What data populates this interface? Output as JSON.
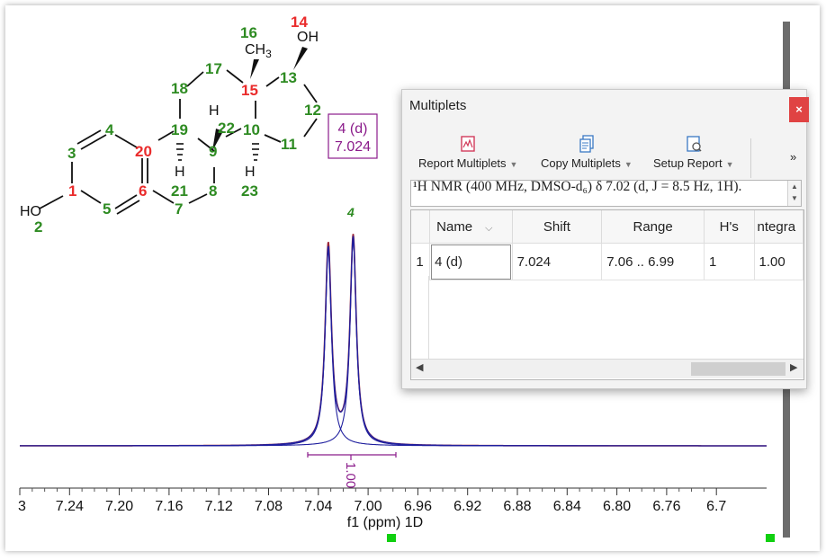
{
  "molecule": {
    "atoms": [
      {
        "label": "1",
        "color": "red"
      },
      {
        "label": "2",
        "color": "green"
      },
      {
        "label": "3",
        "color": "green"
      },
      {
        "label": "4",
        "color": "green"
      },
      {
        "label": "5",
        "color": "green"
      },
      {
        "label": "6",
        "color": "red"
      },
      {
        "label": "7",
        "color": "green"
      },
      {
        "label": "8",
        "color": "green"
      },
      {
        "label": "9",
        "color": "green"
      },
      {
        "label": "10",
        "color": "green"
      },
      {
        "label": "11",
        "color": "green"
      },
      {
        "label": "12",
        "color": "green"
      },
      {
        "label": "13",
        "color": "green"
      },
      {
        "label": "14",
        "color": "red"
      },
      {
        "label": "15",
        "color": "red"
      },
      {
        "label": "16",
        "color": "green"
      },
      {
        "label": "17",
        "color": "green"
      },
      {
        "label": "18",
        "color": "green"
      },
      {
        "label": "19",
        "color": "green"
      },
      {
        "label": "20",
        "color": "red"
      },
      {
        "label": "21",
        "color": "green"
      },
      {
        "label": "22",
        "color": "green"
      },
      {
        "label": "23",
        "color": "green"
      }
    ],
    "hetero": {
      "ho": "HO",
      "oh": "OH",
      "ch3": "CH",
      "ch3_sub": "3",
      "h": "H"
    }
  },
  "peak_label": {
    "name": "4 (d)",
    "shift": "7.024"
  },
  "multiplet_marker": "4",
  "integral_label": "1.00",
  "spectrum": {
    "axis_label": "f1 (ppm) 1D",
    "ticks": [
      "3",
      "7.24",
      "7.20",
      "7.16",
      "7.12",
      "7.08",
      "7.04",
      "7.00",
      "6.96",
      "6.92",
      "6.88",
      "6.84",
      "6.80",
      "6.76",
      "6.7"
    ],
    "peaks_ppm": [
      7.032,
      7.012
    ],
    "colors": {
      "fit": "#1f1f9e",
      "spectrum": "#9b2335",
      "integral": "#8b1c8b",
      "atom_green": "#2e8b22",
      "atom_red": "#ea2c2c"
    }
  },
  "panel": {
    "title": "Multiplets",
    "close": "×",
    "toolbar": [
      {
        "label": "Report Multiplets",
        "icon": "report-multiplets-icon"
      },
      {
        "label": "Copy Multiplets",
        "icon": "copy-multiplets-icon"
      },
      {
        "label": "Setup Report",
        "icon": "setup-report-icon"
      }
    ],
    "more": "»",
    "report_text": "¹H NMR (400 MHz, DMSO-d₆) δ 7.02 (d, J = 8.5 Hz, 1H).",
    "table": {
      "columns": [
        "Name",
        "Shift",
        "Range",
        "H's",
        "ntegra"
      ],
      "rows": [
        {
          "num": "1",
          "name": "4 (d)",
          "shift": "7.024",
          "range": "7.06 .. 6.99",
          "hs": "1",
          "integral": "1.00"
        }
      ]
    }
  }
}
